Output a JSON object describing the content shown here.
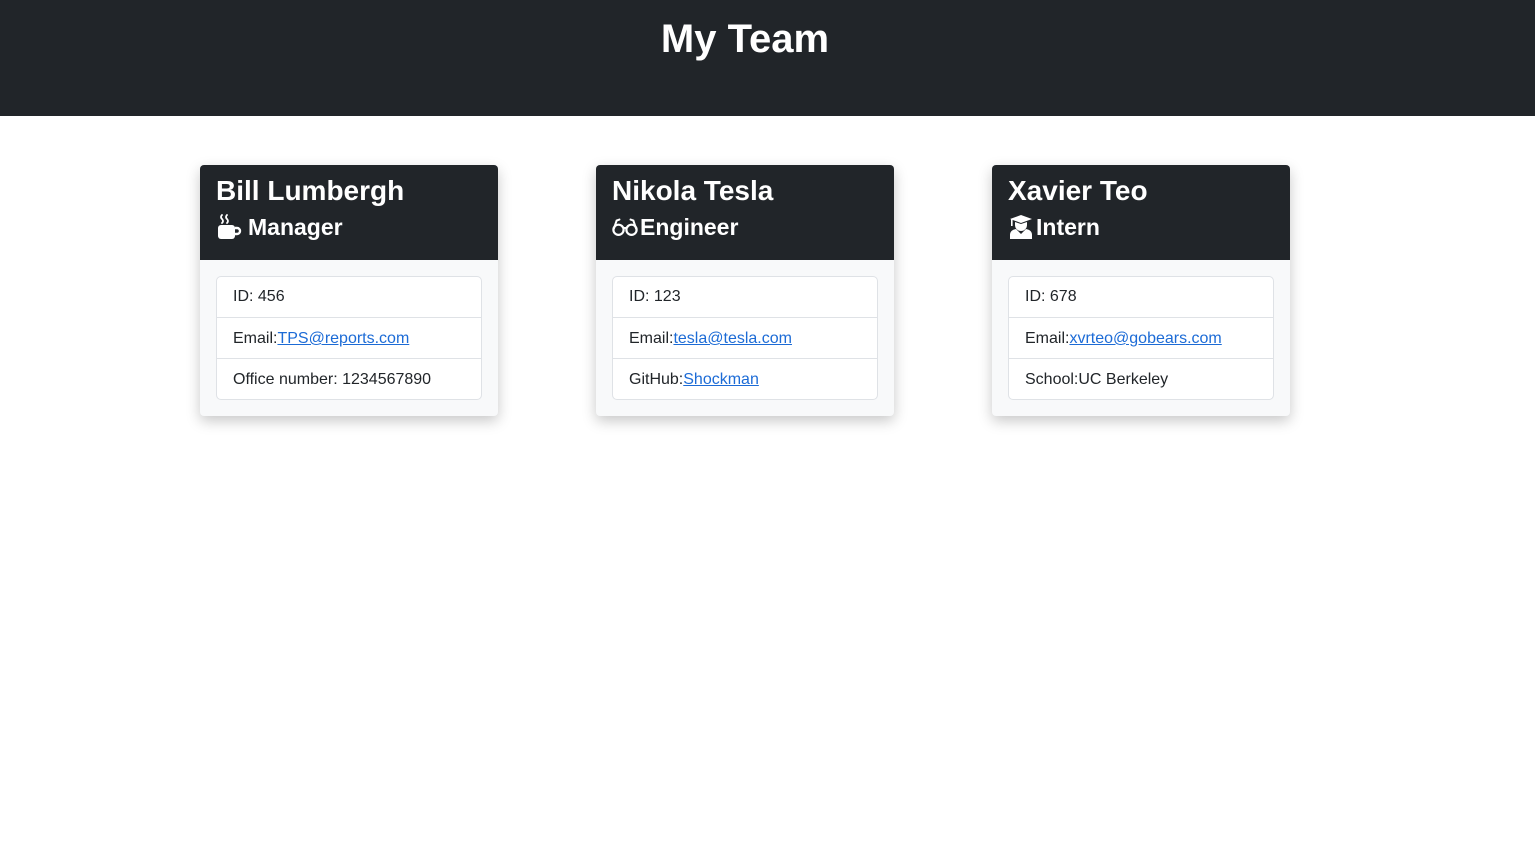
{
  "header": {
    "title": "My Team"
  },
  "cards": [
    {
      "name": "Bill Lumbergh",
      "role": "Manager",
      "icon": "coffee-cup-icon",
      "id_text": "ID: 456",
      "email_label": "Email:",
      "email": "TPS@reports.com",
      "extra_label": "Office number: ",
      "extra_value": "1234567890"
    },
    {
      "name": "Nikola Tesla",
      "role": "Engineer",
      "icon": "glasses-icon",
      "id_text": "ID: 123",
      "email_label": "Email:",
      "email": "tesla@tesla.com",
      "extra_label": "GitHub:",
      "extra_value": "Shockman"
    },
    {
      "name": "Xavier Teo",
      "role": "Intern",
      "icon": "graduate-icon",
      "id_text": "ID: 678",
      "email_label": "Email:",
      "email": "xvrteo@gobears.com",
      "extra_label": "School:",
      "extra_value": "UC Berkeley"
    }
  ],
  "colors": {
    "header_bg": "#212529",
    "card_bg": "#f8f9fa",
    "link": "#1c6bd6"
  }
}
